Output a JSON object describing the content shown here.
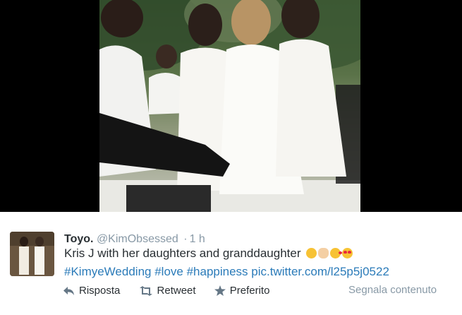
{
  "tweet": {
    "name": "Toyo.",
    "handle": "@KimObsessed",
    "separator": "·",
    "time": "1 h",
    "text_line1": "Kris J with her daughters and granddaughter",
    "hashtags": [
      "#KimyeWedding",
      "#love",
      "#happiness"
    ],
    "media_link": "pic.twitter.com/l25p5j0522",
    "emojis": [
      "relieved-face-icon",
      "ok-hand-icon",
      "face-blowing-kiss-icon",
      "heart-eyes-face-icon"
    ]
  },
  "actions": {
    "reply_label": "Risposta",
    "retweet_label": "Retweet",
    "favorite_label": "Preferito",
    "report_label": "Segnala contenuto"
  },
  "colors": {
    "name": "#292f33",
    "meta": "#8899a6",
    "link": "#2b7bb9",
    "photo_background": "#000000"
  }
}
